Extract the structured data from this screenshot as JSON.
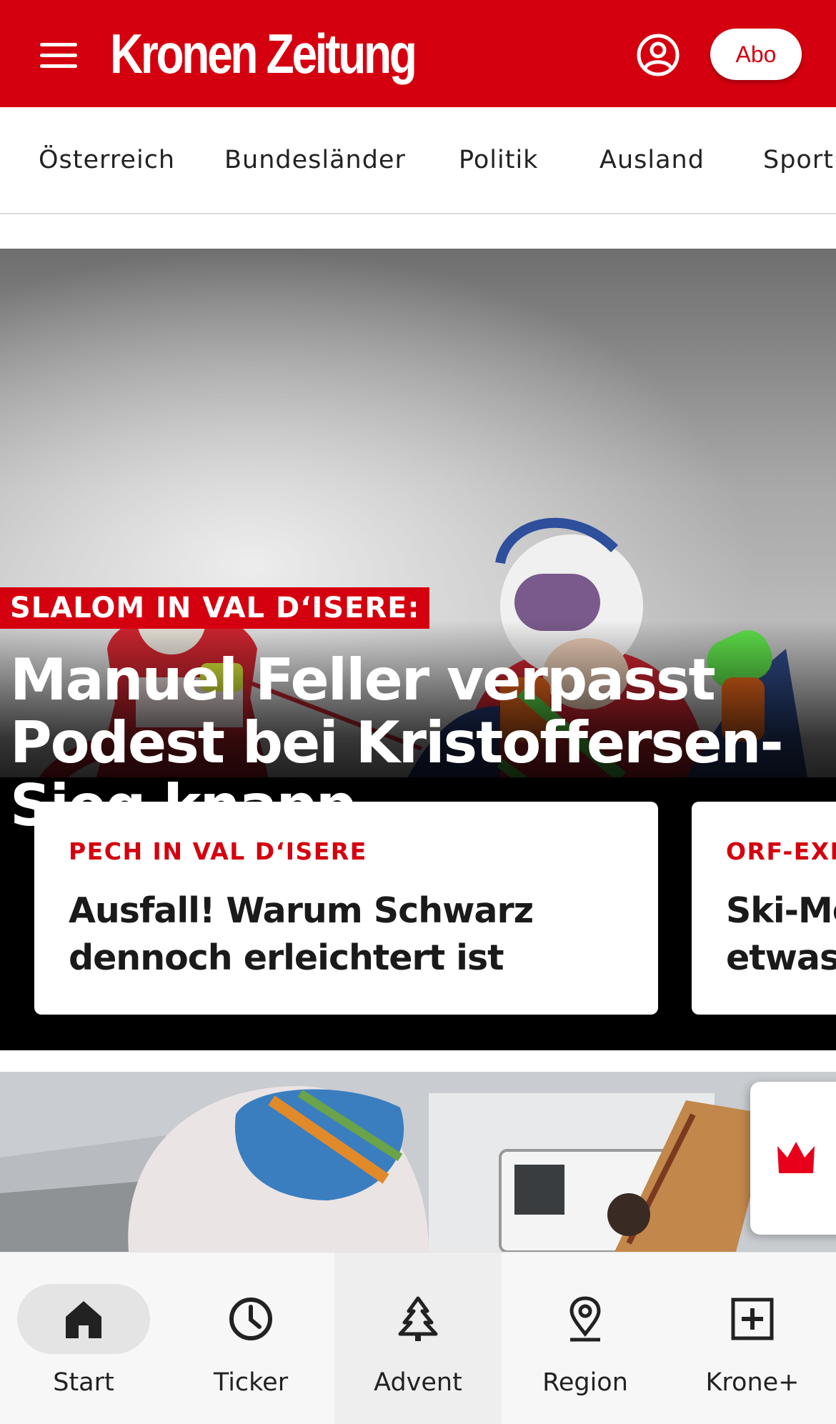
{
  "header": {
    "logo": "Kronen Zeitung",
    "abo_label": "Abo",
    "brand_color": "#d5000f",
    "icons": [
      "menu-icon",
      "user-icon"
    ]
  },
  "nav": {
    "items": [
      {
        "label": "Österreich"
      },
      {
        "label": "Bundesländer"
      },
      {
        "label": "Politik"
      },
      {
        "label": "Ausland"
      },
      {
        "label": "Sport"
      }
    ]
  },
  "hero": {
    "kicker": "SLALOM IN VAL D‘ISERE:",
    "title": "Manuel Feller verpasst Podest bei Kristoffersen-Sieg knapp"
  },
  "cards": [
    {
      "kicker": "PECH IN VAL D‘ISERE",
      "title_line1": "Ausfall! Warum Schwarz",
      "title_line2": "dennoch erleichtert ist"
    },
    {
      "kicker": "ORF-EXPERTE",
      "title_line1": "Ski-Mö",
      "title_line2": "etwas"
    }
  ],
  "floating_button": {
    "icon": "crown-icon"
  },
  "bottom_nav": {
    "tabs": [
      {
        "label": "Start",
        "icon": "home-icon"
      },
      {
        "label": "Ticker",
        "icon": "clock-icon"
      },
      {
        "label": "Advent",
        "icon": "tree-icon"
      },
      {
        "label": "Region",
        "icon": "location-pin-icon"
      },
      {
        "label": "Krone+",
        "icon": "plus-box-icon"
      }
    ]
  }
}
